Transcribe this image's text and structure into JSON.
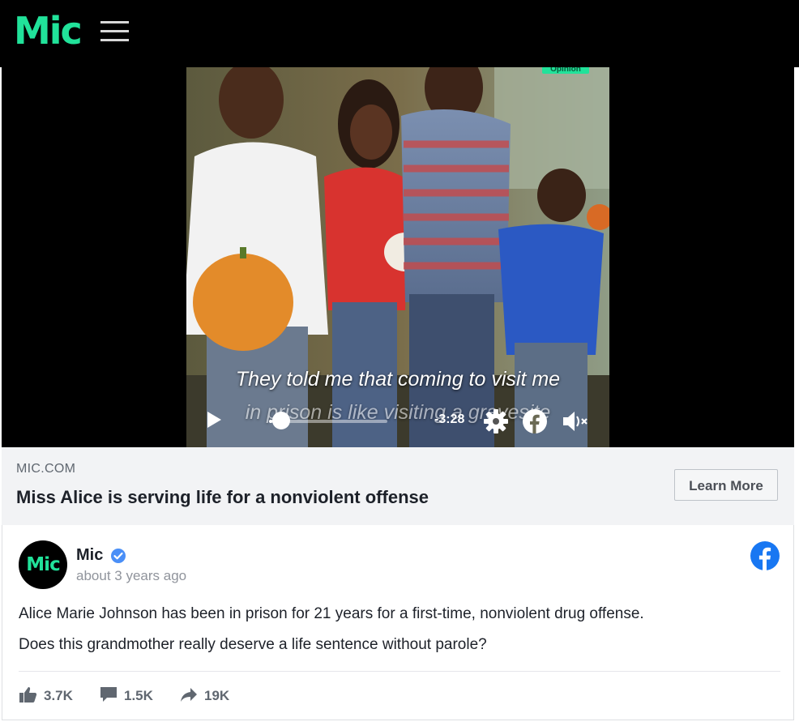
{
  "header": {
    "logo_text": "Mic",
    "menu_icon": "hamburger-menu-icon",
    "background": "#000000",
    "brand_color": "#21e29a"
  },
  "video": {
    "badge_text": "Opinion",
    "caption_line1": "They told me that coming to visit me",
    "caption_line2": "in prison is like visiting a gravesite",
    "time_remaining": "-3:28",
    "progress": 0.03,
    "controls": [
      "play-icon",
      "settings-icon",
      "facebook-icon",
      "mute-icon"
    ]
  },
  "link_preview": {
    "domain": "MIC.COM",
    "title": "Miss Alice is serving life for a nonviolent offense",
    "cta_label": "Learn More"
  },
  "post": {
    "avatar_text": "Mic",
    "page_name": "Mic",
    "verified": true,
    "timestamp": "about 3 years ago",
    "text_line1": "Alice Marie Johnson has been in prison for 21 years for a first-time, nonviolent drug offense.",
    "text_line2": "Does this grandmother really deserve a life sentence without parole?",
    "stats": {
      "likes": "3.7K",
      "comments": "1.5K",
      "shares": "19K"
    }
  },
  "colors": {
    "facebook_blue": "#1877f2",
    "verified_blue": "#4a8ff7",
    "link_bar_bg": "#f2f3f5"
  }
}
